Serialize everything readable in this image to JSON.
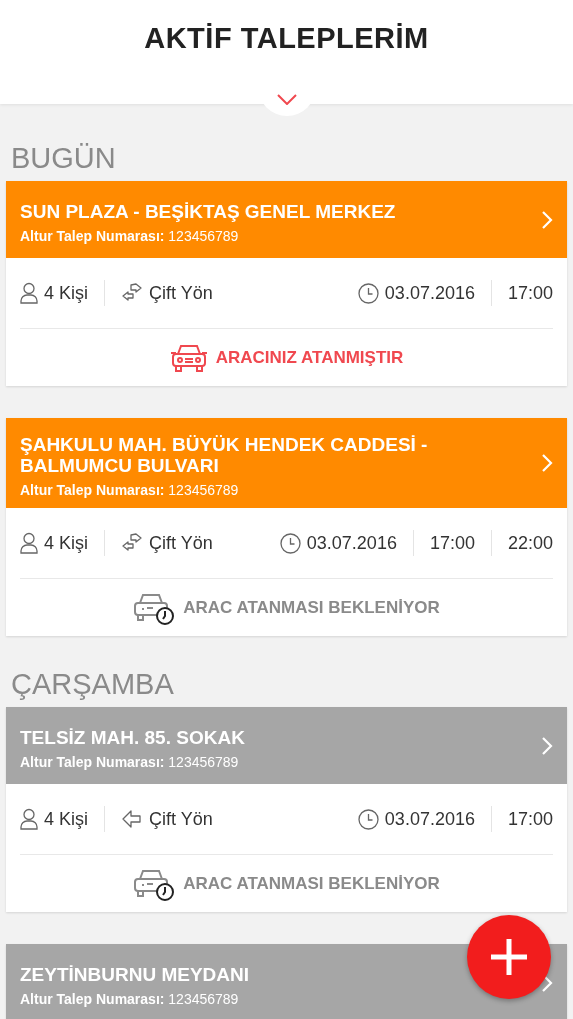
{
  "title": "AKTİF TALEPLERİM",
  "sections": [
    {
      "heading": "BUGÜN",
      "requests": [
        {
          "destination": "SUN PLAZA - BEŞİKTAŞ GENEL MERKEZ",
          "number_label": "Altur Talep Numarası:",
          "number": "123456789",
          "color": "#ff8a00",
          "people": "4 Kişi",
          "direction": {
            "label": "Çift Yön",
            "kind": "round_trip"
          },
          "date": "03.07.2016",
          "times": [
            "17:00"
          ],
          "status": {
            "kind": "assigned",
            "label": "ARACINIZ ATANMIŞTIR"
          }
        },
        {
          "destination": "ŞAHKULU MAH. BÜYÜK HENDEK CADDESİ - BALMUMCU BULVARI",
          "number_label": "Altur Talep Numarası:",
          "number": "123456789",
          "color": "#ff8a00",
          "people": "4 Kişi",
          "direction": {
            "label": "Çift Yön",
            "kind": "round_trip"
          },
          "date": "03.07.2016",
          "times": [
            "17:00",
            "22:00"
          ],
          "status": {
            "kind": "waiting",
            "label": "ARAC ATANMASI BEKLENİYOR"
          }
        }
      ]
    },
    {
      "heading": "ÇARŞAMBA",
      "requests": [
        {
          "destination": "TELSİZ MAH. 85. SOKAK",
          "number_label": "Altur Talep Numarası:",
          "number": "123456789",
          "color": "#a6a6a6",
          "people": "4 Kişi",
          "direction": {
            "label": "Çift Yön",
            "kind": "one_way"
          },
          "date": "03.07.2016",
          "times": [
            "17:00"
          ],
          "status": {
            "kind": "waiting",
            "label": "ARAC ATANMASI BEKLENİYOR"
          }
        },
        {
          "destination": "ZEYTİNBURNU MEYDANI",
          "number_label": "Altur Talep Numarası:",
          "number": "123456789",
          "color": "#a6a6a6"
        }
      ]
    }
  ]
}
